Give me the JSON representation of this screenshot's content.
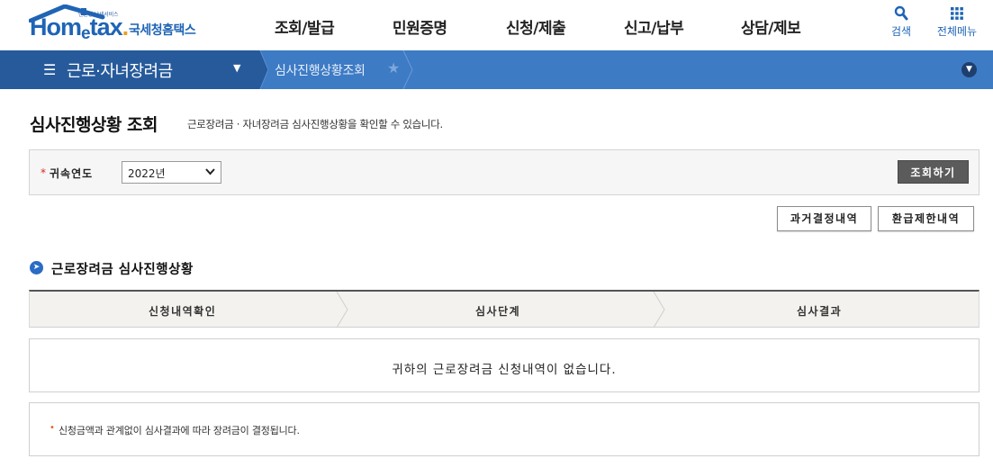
{
  "brand": {
    "tagline": "민원형 납세서비스",
    "logo_home": "Hom",
    "logo_e": "e",
    "logo_tax": "tax",
    "logo_dot": ".",
    "logo_kor": "국세청홈택스"
  },
  "gnb": {
    "items": [
      "조회/발급",
      "민원증명",
      "신청/제출",
      "신고/납부",
      "상담/제보"
    ]
  },
  "util": {
    "search_label": "검색",
    "allmenu_label": "전체메뉴"
  },
  "subnav": {
    "menu_title": "근로·자녀장려금",
    "breadcrumb": "심사진행상황조회"
  },
  "page": {
    "title": "심사진행상황 조회",
    "description": "근로장려금 · 자녀장려금 심사진행상황을 확인할 수 있습니다."
  },
  "search": {
    "required_mark": "*",
    "year_label": "귀속연도",
    "year_value": "2022년",
    "submit_label": "조회하기"
  },
  "actions": {
    "past_decisions": "과거결정내역",
    "refund_limit": "환급제한내역"
  },
  "section": {
    "title": "근로장려금 심사진행상황",
    "steps": [
      "신청내역확인",
      "심사단계",
      "심사결과"
    ]
  },
  "result": {
    "message": "귀하의 근로장려금 신청내역이 없습니다."
  },
  "notice": {
    "text": "신청금액과 관계없이 심사결과에 따라 장려금이 결정됩니다."
  },
  "colors": {
    "brand_blue": "#1f64b5",
    "subnav_dark": "#265a9b",
    "subnav_light": "#3d7bc4",
    "button_dark": "#5b5b5b",
    "required_red": "#d9261c"
  }
}
